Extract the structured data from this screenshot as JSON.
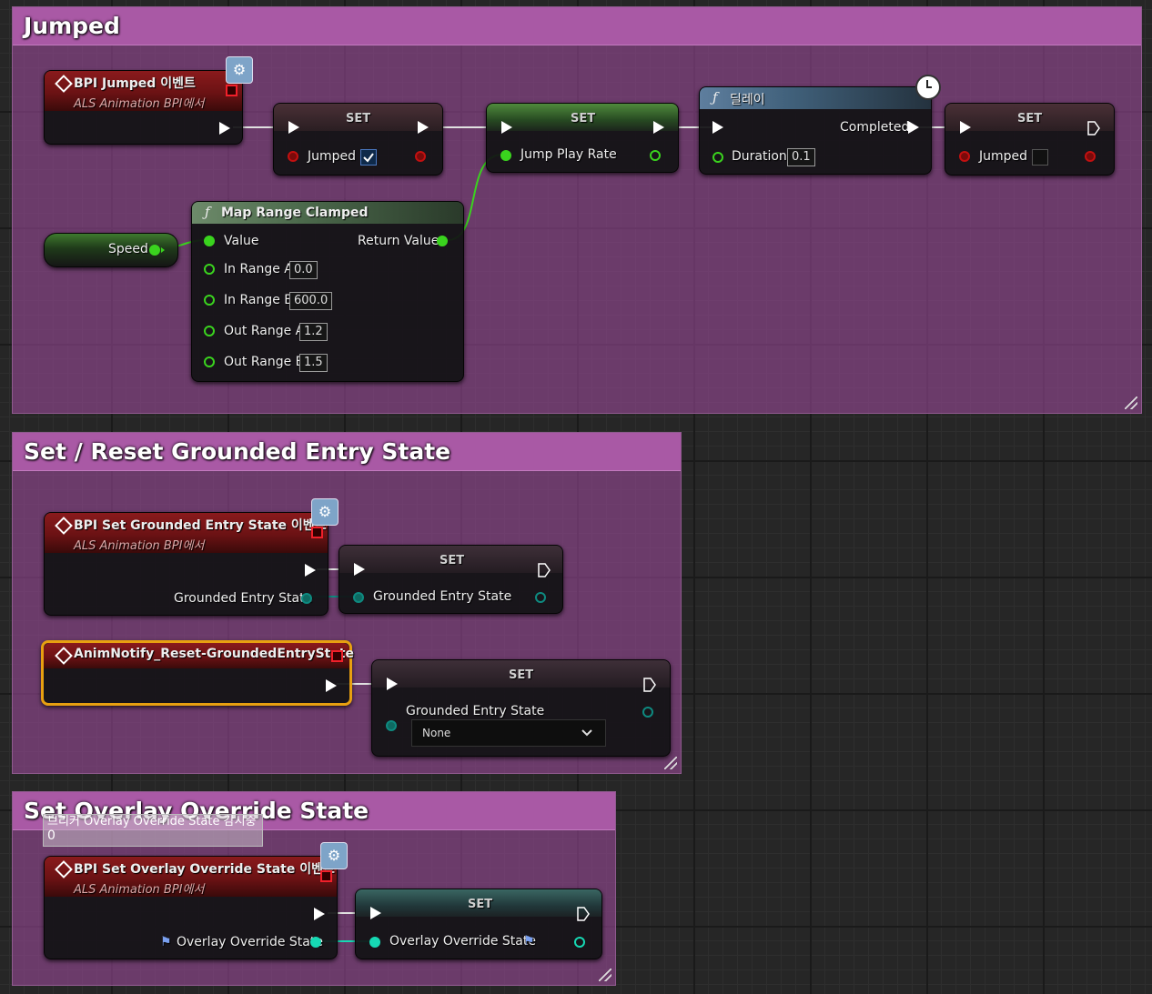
{
  "comments": {
    "jumped": "Jumped",
    "grounded": "Set / Reset Grounded Entry State",
    "overlay": "Set Overlay Override State"
  },
  "nodes": {
    "bpi_jumped": {
      "title": "BPI Jumped 이벤트",
      "subtitle": "ALS Animation BPI에서"
    },
    "set_jumped_1": {
      "title": "SET",
      "var": "Jumped",
      "checked": true
    },
    "set_jump_rate": {
      "title": "SET",
      "var": "Jump Play Rate"
    },
    "delay": {
      "title": "딜레이",
      "completed": "Completed",
      "duration_label": "Duration",
      "duration": "0.1"
    },
    "set_jumped_2": {
      "title": "SET",
      "var": "Jumped",
      "checked": false
    },
    "speed": {
      "label": "Speed"
    },
    "map_range": {
      "title": "Map Range Clamped",
      "value": "Value",
      "return_value": "Return Value",
      "in_range_a": "In Range A",
      "in_range_a_val": "0.0",
      "in_range_b": "In Range B",
      "in_range_b_val": "600.0",
      "out_range_a": "Out Range A",
      "out_range_a_val": "1.2",
      "out_range_b": "Out Range B",
      "out_range_b_val": "1.5"
    },
    "bpi_grounded": {
      "title": "BPI Set Grounded Entry State 이벤트",
      "subtitle": "ALS Animation BPI에서",
      "pin": "Grounded Entry State"
    },
    "set_grounded_1": {
      "title": "SET",
      "var": "Grounded Entry State"
    },
    "anim_notify": {
      "title": "AnimNotify_Reset-GroundedEntryState"
    },
    "set_grounded_2": {
      "title": "SET",
      "var": "Grounded Entry State",
      "dropdown": "None"
    },
    "bpi_overlay": {
      "title": "BPI Set Overlay Override State 이벤트",
      "subtitle": "ALS Animation BPI에서",
      "pin": "Overlay Override State"
    },
    "set_overlay": {
      "title": "SET",
      "var": "Overlay Override State"
    }
  },
  "tooltip": {
    "line1": "브리커 Overlay Override State 감시중",
    "line2": "0"
  },
  "colors": {
    "comment_title": "#a959a5",
    "event_header": "#8a1a1c",
    "float_pin": "#3ad31e",
    "bool_pin": "#c21010",
    "enum_pin": "#0e8a80",
    "byte_pin": "#16d9b4",
    "selected": "#e8a010"
  }
}
